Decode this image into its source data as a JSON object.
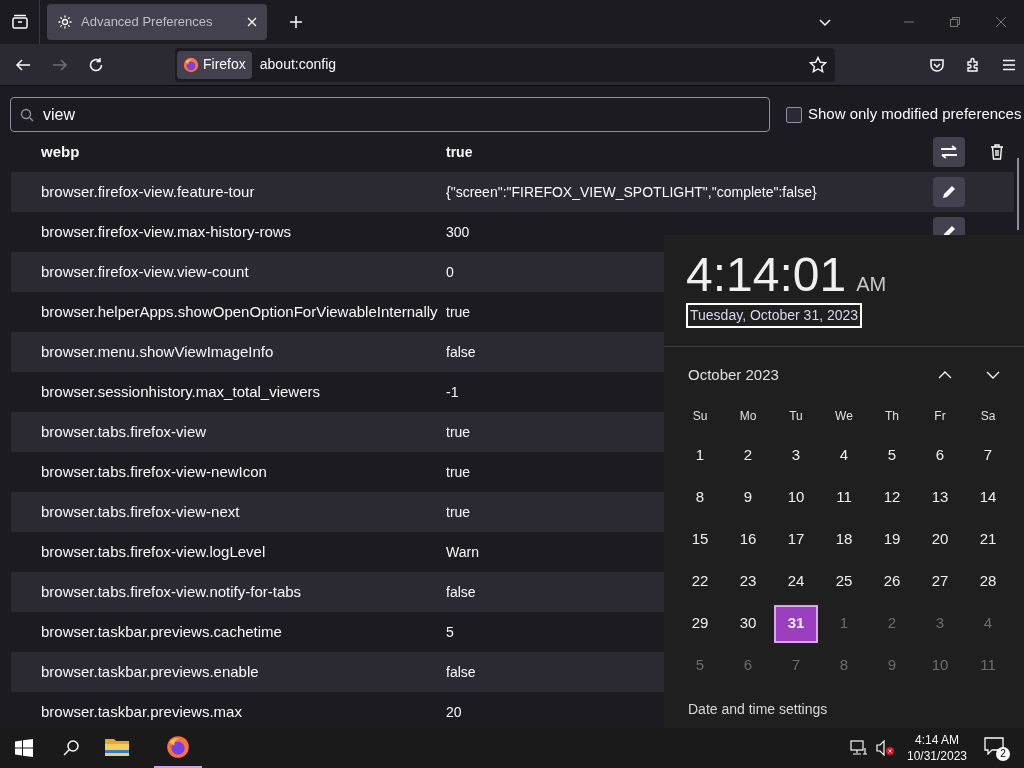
{
  "tab": {
    "title": "Advanced Preferences",
    "selected": true
  },
  "address": {
    "identity": "Firefox",
    "url": "about:config"
  },
  "search": {
    "value": "view"
  },
  "modified_only": {
    "label": "Show only modified preferences",
    "checked": false
  },
  "prefs": [
    {
      "name": "webp",
      "value": "true",
      "modified": true,
      "kind": "toggle"
    },
    {
      "name": "browser.firefox-view.feature-tour",
      "value": "{\"screen\":\"FIREFOX_VIEW_SPOTLIGHT\",\"complete\":false}",
      "modified": false,
      "kind": "edit"
    },
    {
      "name": "browser.firefox-view.max-history-rows",
      "value": "300",
      "modified": false,
      "kind": "edit"
    },
    {
      "name": "browser.firefox-view.view-count",
      "value": "0",
      "modified": false
    },
    {
      "name": "browser.helperApps.showOpenOptionForViewableInternally",
      "value": "true",
      "modified": false
    },
    {
      "name": "browser.menu.showViewImageInfo",
      "value": "false",
      "modified": false
    },
    {
      "name": "browser.sessionhistory.max_total_viewers",
      "value": "-1",
      "modified": false
    },
    {
      "name": "browser.tabs.firefox-view",
      "value": "true",
      "modified": false
    },
    {
      "name": "browser.tabs.firefox-view-newIcon",
      "value": "true",
      "modified": false
    },
    {
      "name": "browser.tabs.firefox-view-next",
      "value": "true",
      "modified": false
    },
    {
      "name": "browser.tabs.firefox-view.logLevel",
      "value": "Warn",
      "modified": false
    },
    {
      "name": "browser.tabs.firefox-view.notify-for-tabs",
      "value": "false",
      "modified": false
    },
    {
      "name": "browser.taskbar.previews.cachetime",
      "value": "5",
      "modified": false
    },
    {
      "name": "browser.taskbar.previews.enable",
      "value": "false",
      "modified": false
    },
    {
      "name": "browser.taskbar.previews.max",
      "value": "20",
      "modified": false
    }
  ],
  "clock": {
    "time": "4:14:01",
    "ampm": "AM",
    "date": "Tuesday, October 31, 2023",
    "month": "October 2023",
    "weekdays": [
      "Su",
      "Mo",
      "Tu",
      "We",
      "Th",
      "Fr",
      "Sa"
    ],
    "weeks": [
      [
        {
          "d": "1",
          "in_month": true,
          "selected": false
        },
        {
          "d": "2",
          "in_month": true,
          "selected": false
        },
        {
          "d": "3",
          "in_month": true,
          "selected": false
        },
        {
          "d": "4",
          "in_month": true,
          "selected": false
        },
        {
          "d": "5",
          "in_month": true,
          "selected": false
        },
        {
          "d": "6",
          "in_month": true,
          "selected": false
        },
        {
          "d": "7",
          "in_month": true,
          "selected": false
        }
      ],
      [
        {
          "d": "8",
          "in_month": true,
          "selected": false
        },
        {
          "d": "9",
          "in_month": true,
          "selected": false
        },
        {
          "d": "10",
          "in_month": true,
          "selected": false
        },
        {
          "d": "11",
          "in_month": true,
          "selected": false
        },
        {
          "d": "12",
          "in_month": true,
          "selected": false
        },
        {
          "d": "13",
          "in_month": true,
          "selected": false
        },
        {
          "d": "14",
          "in_month": true,
          "selected": false
        }
      ],
      [
        {
          "d": "15",
          "in_month": true,
          "selected": false
        },
        {
          "d": "16",
          "in_month": true,
          "selected": false
        },
        {
          "d": "17",
          "in_month": true,
          "selected": false
        },
        {
          "d": "18",
          "in_month": true,
          "selected": false
        },
        {
          "d": "19",
          "in_month": true,
          "selected": false
        },
        {
          "d": "20",
          "in_month": true,
          "selected": false
        },
        {
          "d": "21",
          "in_month": true,
          "selected": false
        }
      ],
      [
        {
          "d": "22",
          "in_month": true,
          "selected": false
        },
        {
          "d": "23",
          "in_month": true,
          "selected": false
        },
        {
          "d": "24",
          "in_month": true,
          "selected": false
        },
        {
          "d": "25",
          "in_month": true,
          "selected": false
        },
        {
          "d": "26",
          "in_month": true,
          "selected": false
        },
        {
          "d": "27",
          "in_month": true,
          "selected": false
        },
        {
          "d": "28",
          "in_month": true,
          "selected": false
        }
      ],
      [
        {
          "d": "29",
          "in_month": true,
          "selected": false
        },
        {
          "d": "30",
          "in_month": true,
          "selected": false
        },
        {
          "d": "31",
          "in_month": true,
          "selected": true
        },
        {
          "d": "1",
          "in_month": false,
          "selected": false
        },
        {
          "d": "2",
          "in_month": false,
          "selected": false
        },
        {
          "d": "3",
          "in_month": false,
          "selected": false
        },
        {
          "d": "4",
          "in_month": false,
          "selected": false
        }
      ],
      [
        {
          "d": "5",
          "in_month": false,
          "selected": false
        },
        {
          "d": "6",
          "in_month": false,
          "selected": false
        },
        {
          "d": "7",
          "in_month": false,
          "selected": false
        },
        {
          "d": "8",
          "in_month": false,
          "selected": false
        },
        {
          "d": "9",
          "in_month": false,
          "selected": false
        },
        {
          "d": "10",
          "in_month": false,
          "selected": false
        },
        {
          "d": "11",
          "in_month": false,
          "selected": false
        }
      ]
    ],
    "settings_link": "Date and time settings"
  },
  "taskbar": {
    "time": "4:14 AM",
    "date": "10/31/2023",
    "notifications": "2",
    "apps": [
      {
        "kind": "explorer",
        "active": false
      },
      {
        "kind": "firefox",
        "active": true
      }
    ]
  }
}
